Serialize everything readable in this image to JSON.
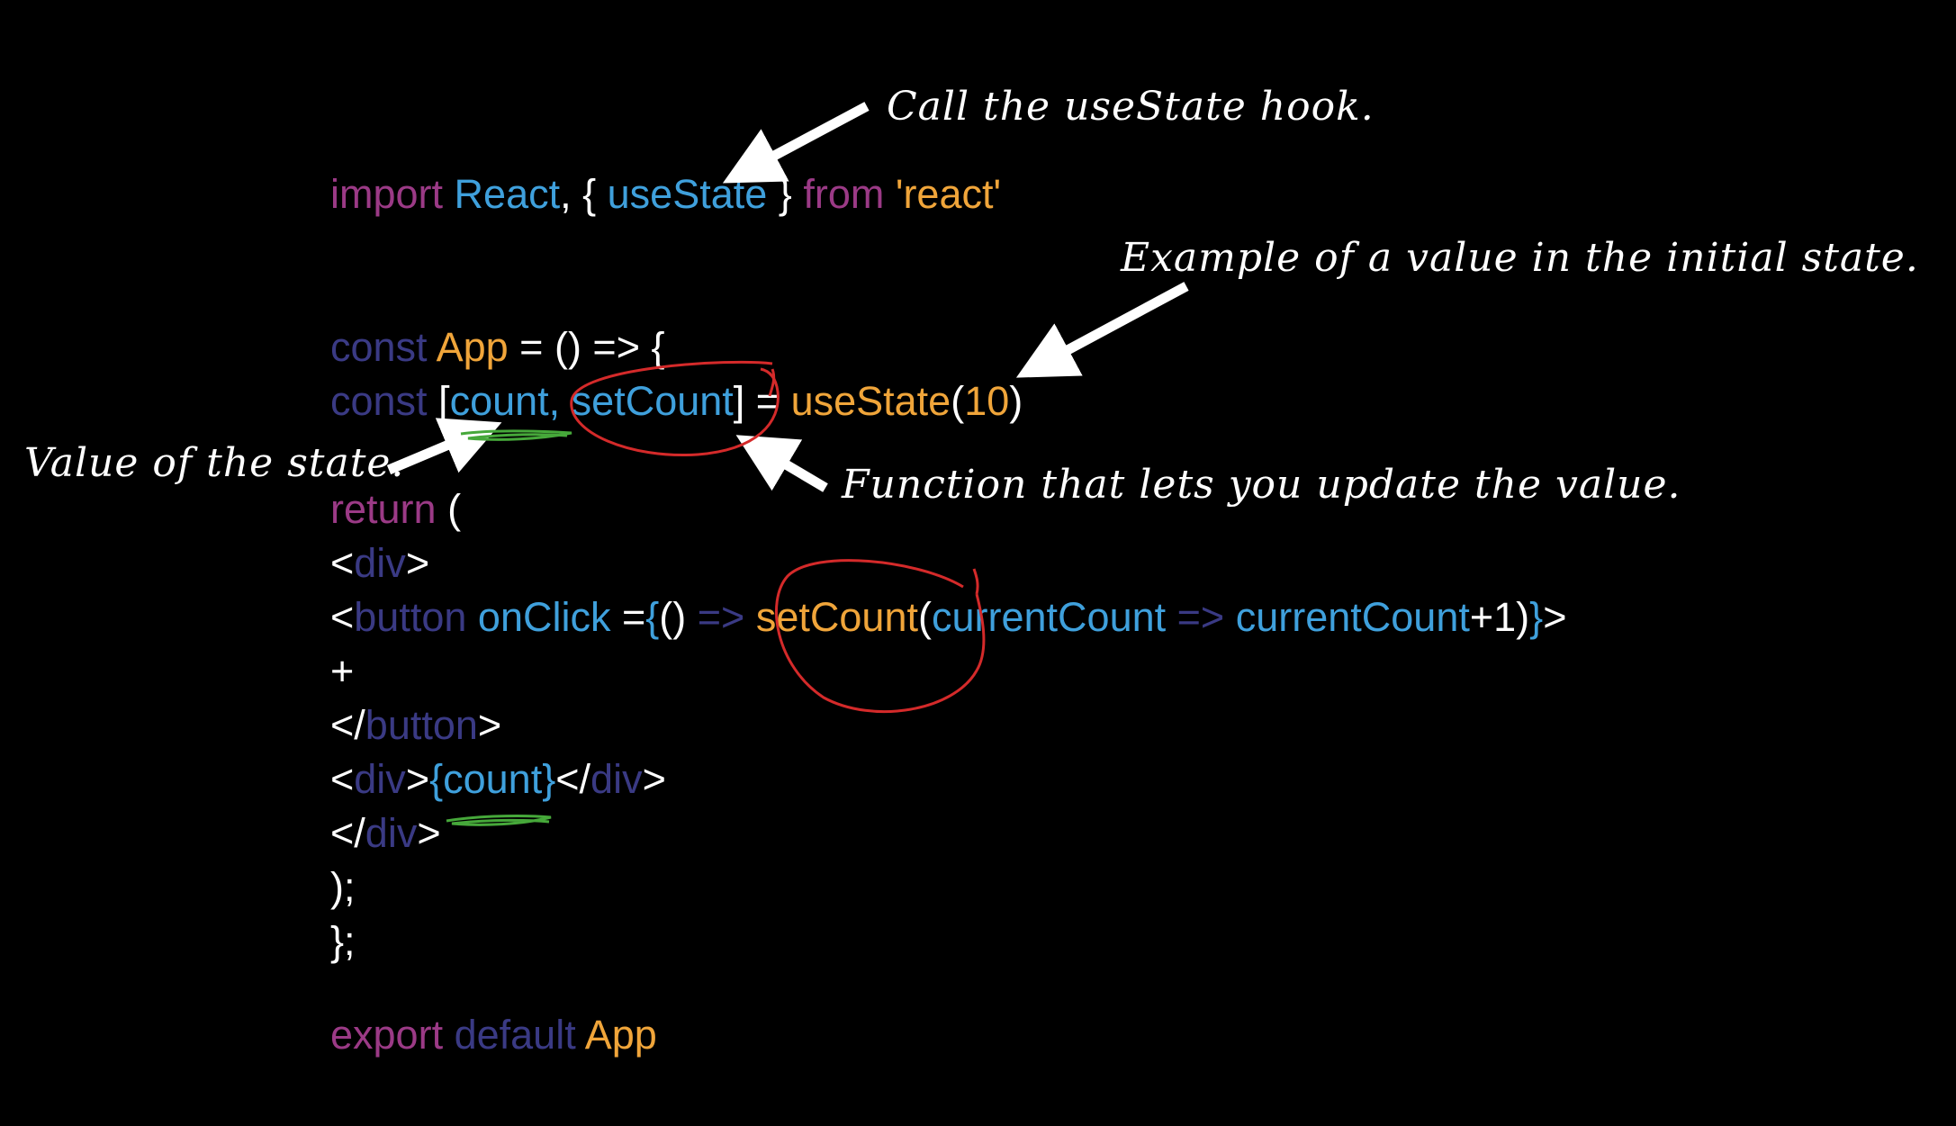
{
  "colors": {
    "background": "#000000",
    "keyword": "#9b3a86",
    "declaration": "#3a3a84",
    "identifier": "#3fa0dc",
    "function_name": "#f0a53a",
    "punctuation": "#ffffff",
    "annotation_text": "#ffffff",
    "arrow": "#ffffff",
    "circle_mark": "#d42a2a",
    "underline_mark": "#46a83a"
  },
  "code": {
    "lines": [
      {
        "tokens": [
          {
            "text": "import",
            "role": "keyword"
          },
          {
            "text": " ",
            "role": "punctuation"
          },
          {
            "text": "React",
            "role": "identifier"
          },
          {
            "text": ", { ",
            "role": "punctuation"
          },
          {
            "text": "useState",
            "role": "identifier"
          },
          {
            "text": " } ",
            "role": "punctuation"
          },
          {
            "text": "from",
            "role": "keyword"
          },
          {
            "text": " ",
            "role": "punctuation"
          },
          {
            "text": "'react'",
            "role": "function_name"
          }
        ]
      },
      {
        "tokens": [
          {
            "text": "const",
            "role": "declaration"
          },
          {
            "text": " ",
            "role": "punctuation"
          },
          {
            "text": "App",
            "role": "function_name"
          },
          {
            "text": " = () => {",
            "role": "punctuation"
          }
        ]
      },
      {
        "tokens": [
          {
            "text": "const",
            "role": "declaration"
          },
          {
            "text": " [",
            "role": "punctuation"
          },
          {
            "text": "count, setCount",
            "role": "identifier"
          },
          {
            "text": "] = ",
            "role": "punctuation"
          },
          {
            "text": "useState",
            "role": "function_name"
          },
          {
            "text": "(",
            "role": "punctuation"
          },
          {
            "text": "10",
            "role": "function_name"
          },
          {
            "text": ")",
            "role": "punctuation"
          }
        ]
      },
      {
        "tokens": [
          {
            "text": "return",
            "role": "keyword"
          },
          {
            "text": " (",
            "role": "punctuation"
          }
        ]
      },
      {
        "tokens": [
          {
            "text": "<",
            "role": "punctuation"
          },
          {
            "text": "div",
            "role": "declaration"
          },
          {
            "text": ">",
            "role": "punctuation"
          }
        ]
      },
      {
        "tokens": [
          {
            "text": "<",
            "role": "punctuation"
          },
          {
            "text": "button",
            "role": "declaration"
          },
          {
            "text": " ",
            "role": "punctuation"
          },
          {
            "text": "onClick",
            "role": "identifier"
          },
          {
            "text": " =",
            "role": "punctuation"
          },
          {
            "text": "{",
            "role": "identifier"
          },
          {
            "text": "() ",
            "role": "punctuation"
          },
          {
            "text": "=>",
            "role": "declaration"
          },
          {
            "text": " ",
            "role": "punctuation"
          },
          {
            "text": "setCount",
            "role": "function_name"
          },
          {
            "text": "(",
            "role": "punctuation"
          },
          {
            "text": "currentCount",
            "role": "identifier"
          },
          {
            "text": " ",
            "role": "punctuation"
          },
          {
            "text": "=>",
            "role": "declaration"
          },
          {
            "text": " ",
            "role": "punctuation"
          },
          {
            "text": "currentCount",
            "role": "identifier"
          },
          {
            "text": "+1)",
            "role": "punctuation"
          },
          {
            "text": "}",
            "role": "identifier"
          },
          {
            "text": ">",
            "role": "punctuation"
          }
        ]
      },
      {
        "tokens": [
          {
            "text": "+",
            "role": "punctuation"
          }
        ]
      },
      {
        "tokens": [
          {
            "text": "</",
            "role": "punctuation"
          },
          {
            "text": "button",
            "role": "declaration"
          },
          {
            "text": ">",
            "role": "punctuation"
          }
        ]
      },
      {
        "tokens": [
          {
            "text": "<",
            "role": "punctuation"
          },
          {
            "text": "div",
            "role": "declaration"
          },
          {
            "text": ">",
            "role": "punctuation"
          },
          {
            "text": "{count}",
            "role": "identifier"
          },
          {
            "text": "</",
            "role": "punctuation"
          },
          {
            "text": "div",
            "role": "declaration"
          },
          {
            "text": ">",
            "role": "punctuation"
          }
        ]
      },
      {
        "tokens": [
          {
            "text": "</",
            "role": "punctuation"
          },
          {
            "text": "div",
            "role": "declaration"
          },
          {
            "text": ">",
            "role": "punctuation"
          }
        ]
      },
      {
        "tokens": [
          {
            "text": ");",
            "role": "punctuation"
          }
        ]
      },
      {
        "tokens": [
          {
            "text": "};",
            "role": "punctuation"
          }
        ]
      },
      {
        "tokens": [
          {
            "text": "export",
            "role": "keyword"
          },
          {
            "text": " ",
            "role": "punctuation"
          },
          {
            "text": "default",
            "role": "declaration"
          },
          {
            "text": " ",
            "role": "punctuation"
          },
          {
            "text": "App",
            "role": "function_name"
          }
        ]
      }
    ]
  },
  "annotations": {
    "call_hook": "Call the useState hook.",
    "initial_value": "Example of a value in the initial state.",
    "state_value": "Value of the state.",
    "updater_function": "Function that lets you update the value."
  }
}
